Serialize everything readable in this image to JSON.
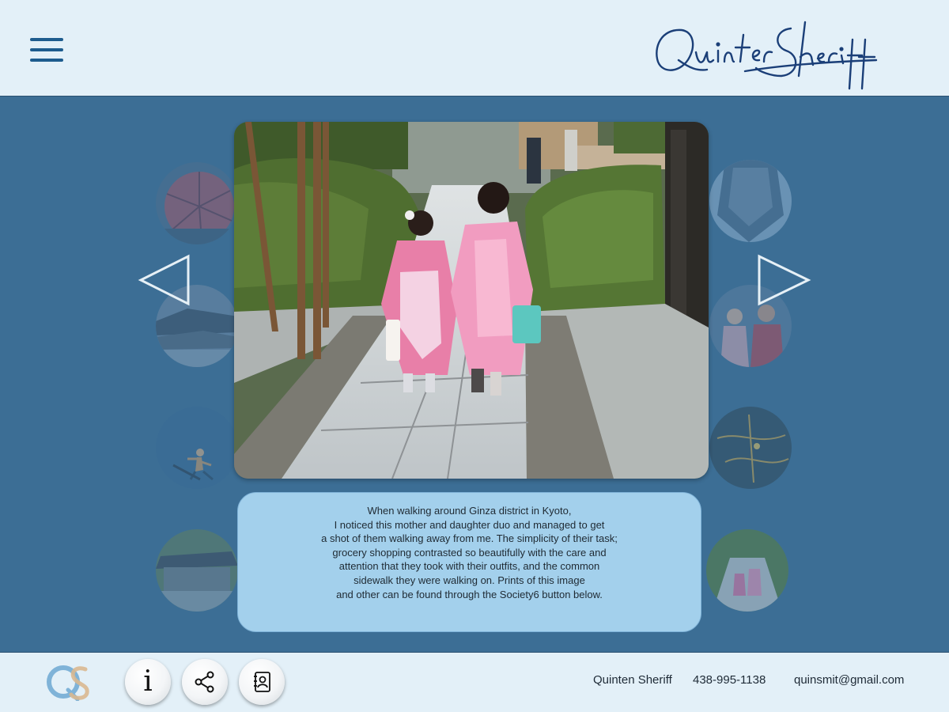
{
  "header": {
    "menu_icon": "hamburger-menu-icon",
    "signature_text": "Quinten Sheriff"
  },
  "gallery": {
    "featured_image": "Two girls in pink kimonos walking hand in hand along a stone sidewalk",
    "prev_icon": "triangle-left-icon",
    "next_icon": "triangle-right-icon",
    "caption_lines": [
      "When walking around Ginza district in Kyoto,",
      "I noticed this mother and daughter duo and managed to get",
      "a shot of them walking away from me. The simplicity of their task;",
      "grocery shopping contrasted so beautifully with the care and",
      "attention that they  took with their outfits, and the common",
      "sidewalk they were walking on. Prints of this image",
      "and other can be found through the Society6 button below."
    ]
  },
  "footer": {
    "logo_text": "QS",
    "info_label": "i",
    "share_icon": "share-icon",
    "contact_icon": "contact-book-icon",
    "name": "Quinten Sheriff",
    "phone": "438-995-1138",
    "email": "quinsmit@gmail.com"
  },
  "colors": {
    "header_bg": "#e3f0f8",
    "main_bg": "#3c6e95",
    "caption_bg": "#a3d0ec",
    "accent": "#1d5c8e"
  }
}
